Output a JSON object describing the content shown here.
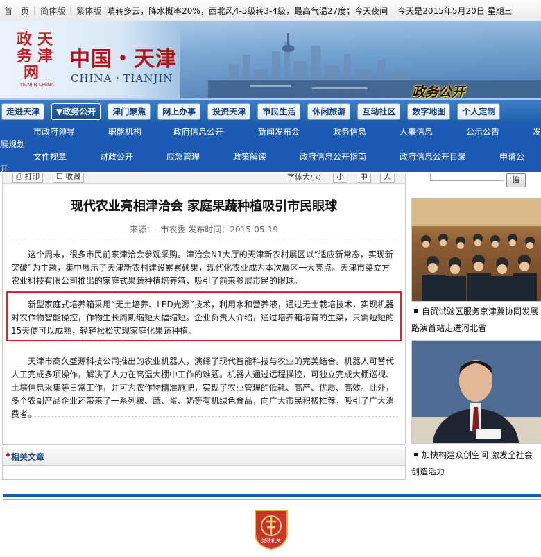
{
  "topbar": {
    "home": "首　页",
    "simplified": "简体版",
    "traditional": "繁体版",
    "weather": "晴转多云，降水概率20%，西北风4-5级转3-4级，最高气温27度；今天夜间",
    "date": "今天是2015年5月20日  星期三"
  },
  "banner": {
    "seal_chars": [
      "天",
      "津",
      "政",
      "务",
      "网"
    ],
    "seal_sub": "TIANJIN CHINA",
    "title": "中国・天津",
    "title_en": "CHINA・TIANJIN",
    "zwgk": "政务公开"
  },
  "mainnav": [
    "走进天津",
    "政务公开",
    "津门聚焦",
    "网上办事",
    "投资天津",
    "市民生活",
    "休闲旅游",
    "互动社区",
    "数字地图",
    "个人定制"
  ],
  "subnav": {
    "row1": [
      "市政府领导",
      "职能机构",
      "政府信息公开",
      "新闻发布会",
      "政务信息",
      "人事信息",
      "公示公告",
      "发"
    ],
    "row1_wrap": "展规划",
    "row2": [
      "文件规章",
      "财政公开",
      "应急管理",
      "政策解读",
      "政府信息公开指南",
      "政府信息公开目录",
      "申请公"
    ],
    "row2_wrap": "开"
  },
  "toolbar": {
    "print": "打印",
    "favorite": "收藏",
    "font_size_label": "字体大小：",
    "sizes": [
      "小",
      "中",
      "大"
    ]
  },
  "article": {
    "title": "现代农业亮相津洽会 家庭果蔬种植吸引市民眼球",
    "source": "来源：--市农委  发布时间：2015-05-19",
    "p1": "这个周末，很多市民前来津洽会参观采购。津洽会N1大厅的天津新农村展区以“适应新常态，实现新突破”为主题，集中展示了天津新农村建设累累硕果，现代化农业成为本次展区一大亮点。天津市菜立方农业科技有限公司推出的家庭式果蔬种植培养箱，吸引了前来参展市民的眼球。",
    "p2": "新型家庭式培养箱采用“无土培养、LED光源”技术，利用水和营养液，通过无土栽培技术，实现机器对农作物智能操控，作物生长周期缩短大幅缩短。企业负责人介绍，通过培养箱培育的生菜，只需短短的15天便可以成熟，轻轻松松实现家庭化果蔬种植。",
    "p3": "天津市商久盛源科技公司推出的农业机器人，演绎了现代智能科技与农业的完美结合。机器人可替代人工完成多项操作，解决了人力在高温大棚中工作的难题。机器人通过远程操控，可独立完成大棚巡视、土壤信息采集等日常工作，并可为农作物精准施肥，实现了农业管理的低耗、高产、优质、高效。此外，多个农副产品企业还带来了一系列粮、蔬、蛋、奶等有机绿色食品，向广大市民积极推荐，吸引了广大消费者。"
  },
  "related": {
    "title": "相关文章"
  },
  "sidebar": {
    "search_button": "搜",
    "news": [
      "自贸试验区服务京津冀协同发展路演首站走进河北省",
      "加快构建众创空间 激发全社会创造活力"
    ]
  },
  "footer": {
    "badge_text": "党政机关"
  },
  "colors": {
    "nav_blue": "#1c5ab3",
    "brand_red": "#b1121a",
    "highlight_red": "#e2252b"
  }
}
